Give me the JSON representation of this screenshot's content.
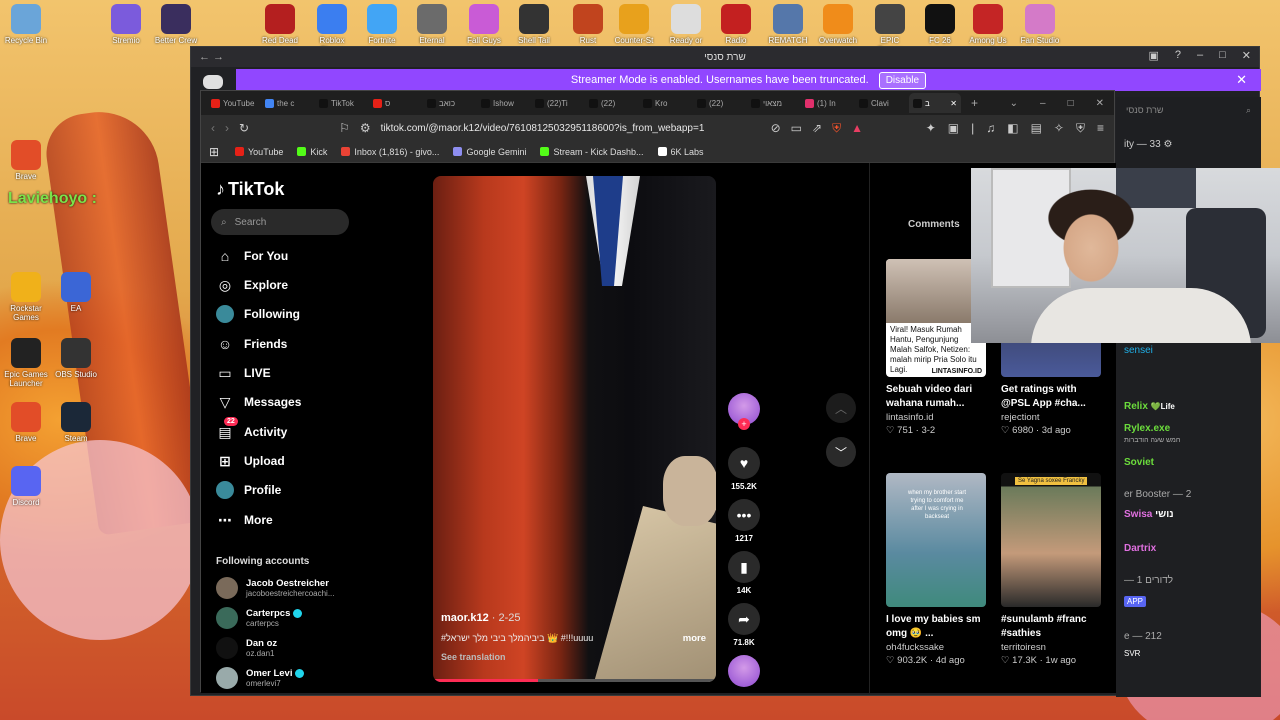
{
  "desktop": {
    "top_icons": [
      {
        "label": "Recycle Bin",
        "color": "#6aa5d9"
      },
      {
        "label": "Stremio",
        "color": "#7b5bdc"
      },
      {
        "label": "Better Crew",
        "color": "#3a2e5e"
      },
      {
        "label": "Red Dead",
        "color": "#b41f1f"
      },
      {
        "label": "Roblox Player",
        "color": "#3b7ef0"
      },
      {
        "label": "Fortnite",
        "color": "#42a5f5"
      },
      {
        "label": "Eternal",
        "color": "#6b6b6b"
      },
      {
        "label": "Fall Guys",
        "color": "#c95bd6"
      },
      {
        "label": "Shell Tail",
        "color": "#333"
      },
      {
        "label": "Rust",
        "color": "#c1441e"
      },
      {
        "label": "Counter-St",
        "color": "#e8a11c"
      },
      {
        "label": "Ready or",
        "color": "#ddd"
      },
      {
        "label": "Radio",
        "color": "#c32020"
      },
      {
        "label": "REMATCH",
        "color": "#5577aa"
      },
      {
        "label": "Overwatch",
        "color": "#f08c1a"
      },
      {
        "label": "EPIC Games",
        "color": "#444"
      },
      {
        "label": "FC 26",
        "color": "#111"
      },
      {
        "label": "Among Us",
        "color": "#c42525"
      },
      {
        "label": "Fan Studio",
        "color": "#d47ac8"
      }
    ],
    "left_icons": [
      {
        "label": "Brave",
        "color": "#e24d28"
      },
      {
        "label": "Rockstar Games",
        "color": "#f0b11a"
      },
      {
        "label": "EA",
        "color": "#3b66d6"
      },
      {
        "label": "Epic Games Launcher",
        "color": "#222"
      },
      {
        "label": "OBS Studio",
        "color": "#333"
      },
      {
        "label": "Brave",
        "color": "#e24d28"
      },
      {
        "label": "Steam",
        "color": "#1b2838"
      },
      {
        "label": "Discord",
        "color": "#5865f2"
      }
    ],
    "side_text": "Laviehoyo :"
  },
  "outer_window": {
    "title": "שרת סנסי",
    "streamer_banner": "Streamer Mode is enabled. Usernames have been truncated.",
    "disable_label": "Disable",
    "chat": {
      "search": "שרת סנסי",
      "items": [
        "ity — 33",
        "sensei",
        "Relix",
        "Life",
        "Rylex.exe",
        "חמש שעה הודברות",
        "Soviet",
        "er Booster — 2",
        "Swisa",
        "נושי",
        "Dartrix",
        "— 1 לדורים",
        "APP",
        "e — 212",
        "SVR"
      ]
    }
  },
  "browser": {
    "tabs": [
      {
        "label": "YouTube",
        "color": "#e62117"
      },
      {
        "label": "the c",
        "color": "#4285f4"
      },
      {
        "label": "TikTok",
        "color": "#111"
      },
      {
        "label": "ס",
        "color": "#e62117"
      },
      {
        "label": "כואב",
        "color": "#111"
      },
      {
        "label": "Ishow",
        "color": "#111"
      },
      {
        "label": "(22)Ti",
        "color": "#111"
      },
      {
        "label": "(22)",
        "color": "#111"
      },
      {
        "label": "Kro",
        "color": "#111"
      },
      {
        "label": "(22)",
        "color": "#111"
      },
      {
        "label": "מצאוי",
        "color": "#111"
      },
      {
        "label": "(1) In",
        "color": "#e1306c"
      },
      {
        "label": "Clavi",
        "color": "#111"
      },
      {
        "label": "ב",
        "color": "#111"
      }
    ],
    "url": "tiktok.com/@maor.k12/video/7610812503295118600?is_from_webapp=1",
    "bookmarks": [
      {
        "label": "YouTube",
        "color": "#e62117"
      },
      {
        "label": "Kick",
        "color": "#53fc18"
      },
      {
        "label": "Inbox (1,816) - givo...",
        "color": "#ea4335"
      },
      {
        "label": "Google Gemini",
        "color": "#8e8ef0"
      },
      {
        "label": "Stream - Kick Dashb...",
        "color": "#53fc18"
      },
      {
        "label": "6K Labs",
        "color": "#fff"
      }
    ]
  },
  "tiktok": {
    "logo": "TikTok",
    "search_placeholder": "Search",
    "nav": [
      {
        "label": "For You",
        "icon": "home-icon",
        "glyph": "⌂"
      },
      {
        "label": "Explore",
        "icon": "compass-icon",
        "glyph": "◎"
      },
      {
        "label": "Following",
        "icon": "avatar-icon",
        "glyph": "●"
      },
      {
        "label": "Friends",
        "icon": "friends-icon",
        "glyph": "☺"
      },
      {
        "label": "LIVE",
        "icon": "live-icon",
        "glyph": "▭"
      },
      {
        "label": "Messages",
        "icon": "send-icon",
        "glyph": "▽"
      },
      {
        "label": "Activity",
        "icon": "inbox-icon",
        "glyph": "▤",
        "badge": "22"
      },
      {
        "label": "Upload",
        "icon": "plus-square-icon",
        "glyph": "⊞"
      },
      {
        "label": "Profile",
        "icon": "profile-icon",
        "glyph": "●"
      },
      {
        "label": "More",
        "icon": "more-icon",
        "glyph": "⋯"
      }
    ],
    "following_heading": "Following accounts",
    "accounts": [
      {
        "name": "Jacob Oestreicher",
        "handle": "jacoboestreichercoachi...",
        "verified": false,
        "color": "#7a6a5a"
      },
      {
        "name": "Carterpcs",
        "handle": "carterpcs",
        "verified": true,
        "color": "#3a6a5a"
      },
      {
        "name": "Dan oz",
        "handle": "oz.dan1",
        "verified": false,
        "color": "#111"
      },
      {
        "name": "Omer Levi",
        "handle": "omerlevi7",
        "verified": true,
        "color": "#9aa"
      }
    ],
    "video": {
      "author": "maor.k12",
      "date": "· 2-25",
      "description": "#ביביהמלך ביבי מלך ישראל 👑 #!!!uuuu",
      "more": "more",
      "see_translation": "See translation",
      "progress": 0.37
    },
    "actions": {
      "likes": "155.2K",
      "comments": "1217",
      "saves": "14K",
      "shares": "71.8K"
    },
    "comments_tab": "Comments",
    "cards": [
      {
        "title": "Sebuah video dari wahana rumah...",
        "author": "lintasinfo.id",
        "stats": "♡ 751 · 3-2",
        "caption": "Viral! Masuk Rumah Hantu, Pengunjung Malah Salfok, Netizen: malah mirip Pria Solo itu Lagi.",
        "brand": "LINTASINFO.ID"
      },
      {
        "title": "Get ratings with @PSL App #cha...",
        "author": "rejectiont",
        "stats": "♡ 6980 · 3d ago"
      },
      {
        "title": "I love my babies sm omg 🥹 ...",
        "author": "oh4fuckssake",
        "stats": "♡ 903.2K · 4d ago",
        "caption": "when my brother start trying to comfort me after I was crying in backseat"
      },
      {
        "title": "#sunulamb #franc #sathies",
        "author": "territoiresn",
        "stats": "♡ 17.3K · 1w ago",
        "caption": "Se Yagna soxee Francky"
      }
    ]
  }
}
